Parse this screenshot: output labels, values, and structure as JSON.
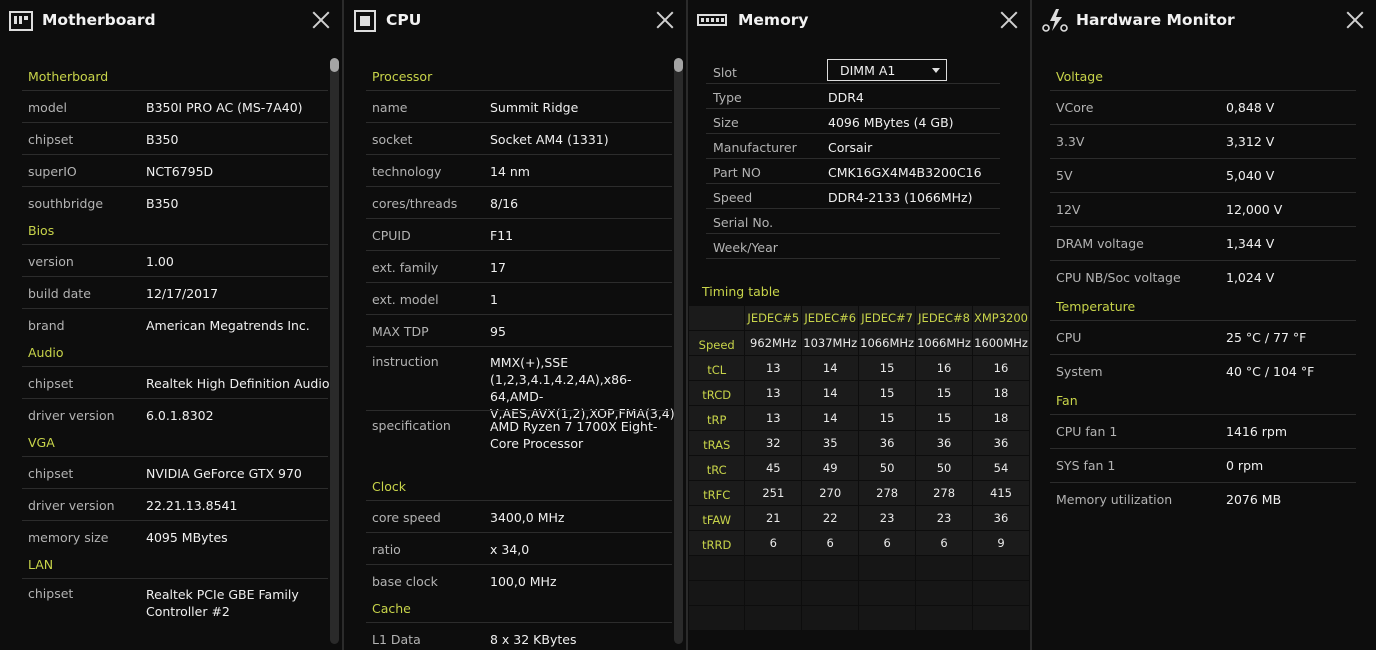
{
  "panels": {
    "motherboard": {
      "title": "Motherboard",
      "icon": "motherboard-icon"
    },
    "cpu": {
      "title": "CPU",
      "icon": "cpu-icon"
    },
    "memory": {
      "title": "Memory",
      "icon": "memory-icon"
    },
    "hardware": {
      "title": "Hardware Monitor",
      "icon": "hardware-monitor-icon"
    }
  },
  "motherboard": {
    "sections": [
      {
        "title": "Motherboard",
        "rows": [
          [
            "model",
            "B350I PRO AC (MS-7A40)"
          ],
          [
            "chipset",
            "B350"
          ],
          [
            "superIO",
            "NCT6795D"
          ],
          [
            "southbridge",
            "B350"
          ]
        ]
      },
      {
        "title": "Bios",
        "rows": [
          [
            "version",
            "1.00"
          ],
          [
            "build date",
            "12/17/2017"
          ],
          [
            "brand",
            "American Megatrends Inc."
          ]
        ]
      },
      {
        "title": "Audio",
        "rows": [
          [
            "chipset",
            "Realtek High Definition Audio"
          ],
          [
            "driver version",
            "6.0.1.8302"
          ]
        ]
      },
      {
        "title": "VGA",
        "rows": [
          [
            "chipset",
            "NVIDIA GeForce GTX 970"
          ],
          [
            "driver version",
            "22.21.13.8541"
          ],
          [
            "memory size",
            "4095 MBytes"
          ]
        ]
      },
      {
        "title": "LAN",
        "rows": [
          [
            "chipset",
            "Realtek PCIe GBE Family Controller #2"
          ]
        ]
      }
    ]
  },
  "cpu": {
    "sections": [
      {
        "title": "Processor",
        "rows": [
          [
            "name",
            "Summit Ridge"
          ],
          [
            "socket",
            "Socket AM4 (1331)"
          ],
          [
            "technology",
            "14 nm"
          ],
          [
            "cores/threads",
            "8/16"
          ],
          [
            "CPUID",
            "F11"
          ],
          [
            "ext. family",
            "17"
          ],
          [
            "ext. model",
            "1"
          ],
          [
            "MAX TDP",
            "95"
          ],
          [
            "instruction",
            "MMX(+),SSE (1,2,3,4.1,4.2,4A),x86-64,AMD-V,AES,AVX(1,2),XOP,FMA(3,4)"
          ],
          [
            "specification",
            "AMD Ryzen 7 1700X Eight-Core Processor"
          ]
        ]
      },
      {
        "title": "Clock",
        "rows": [
          [
            "core speed",
            "3400,0 MHz"
          ],
          [
            "ratio",
            "x 34,0"
          ],
          [
            "base clock",
            "100,0 MHz"
          ]
        ]
      },
      {
        "title": "Cache",
        "rows": [
          [
            "L1 Data",
            "8 x 32 KBytes"
          ]
        ]
      }
    ]
  },
  "memory": {
    "slot_label": "Slot",
    "slot_value": "DIMM A1",
    "rows": [
      [
        "Type",
        "DDR4"
      ],
      [
        "Size",
        "4096 MBytes (4 GB)"
      ],
      [
        "Manufacturer",
        "Corsair"
      ],
      [
        "Part NO",
        "CMK16GX4M4B3200C16"
      ],
      [
        "Speed",
        "DDR4-2133 (1066MHz)"
      ],
      [
        "Serial No.",
        ""
      ],
      [
        "Week/Year",
        ""
      ]
    ],
    "timing_title": "Timing table",
    "timing_cols": [
      "JEDEC#5",
      "JEDEC#6",
      "JEDEC#7",
      "JEDEC#8",
      "XMP3200"
    ],
    "timing_rows": [
      [
        "Speed",
        "962MHz",
        "1037MHz",
        "1066MHz",
        "1066MHz",
        "1600MHz"
      ],
      [
        "tCL",
        "13",
        "14",
        "15",
        "16",
        "16"
      ],
      [
        "tRCD",
        "13",
        "14",
        "15",
        "15",
        "18"
      ],
      [
        "tRP",
        "13",
        "14",
        "15",
        "15",
        "18"
      ],
      [
        "tRAS",
        "32",
        "35",
        "36",
        "36",
        "36"
      ],
      [
        "tRC",
        "45",
        "49",
        "50",
        "50",
        "54"
      ],
      [
        "tRFC",
        "251",
        "270",
        "278",
        "278",
        "415"
      ],
      [
        "tFAW",
        "21",
        "22",
        "23",
        "23",
        "36"
      ],
      [
        "tRRD",
        "6",
        "6",
        "6",
        "6",
        "9"
      ]
    ]
  },
  "hardware": {
    "sections": [
      {
        "title": "Voltage",
        "rows": [
          [
            "VCore",
            "0,848 V"
          ],
          [
            "3.3V",
            "3,312 V"
          ],
          [
            "5V",
            "5,040 V"
          ],
          [
            "12V",
            "12,000 V"
          ],
          [
            "DRAM voltage",
            "1,344 V"
          ],
          [
            "CPU NB/Soc voltage",
            "1,024 V"
          ]
        ]
      },
      {
        "title": "Temperature",
        "rows": [
          [
            "CPU",
            "25 °C / 77 °F"
          ],
          [
            "System",
            "40 °C / 104 °F"
          ]
        ]
      },
      {
        "title": "Fan",
        "rows": [
          [
            "CPU fan 1",
            "1416 rpm"
          ],
          [
            "SYS fan 1",
            "0 rpm"
          ],
          [
            "Memory utilization",
            "2076 MB"
          ]
        ]
      }
    ]
  },
  "colors": {
    "accent": "#c8d44a",
    "background": "#0d0d0d"
  }
}
